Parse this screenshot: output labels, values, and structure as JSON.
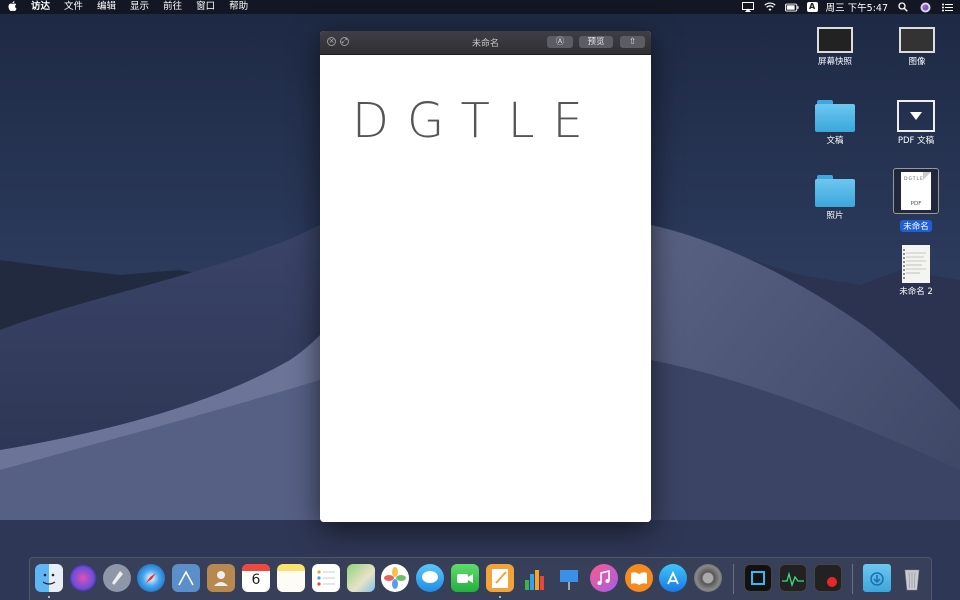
{
  "menubar": {
    "apple": "",
    "items": [
      "访达",
      "文件",
      "编辑",
      "显示",
      "前往",
      "窗口",
      "帮助"
    ],
    "battery": "",
    "input_method": "A",
    "clock": "周三 下午5:47"
  },
  "window": {
    "title": "未命名",
    "markup_button": "Ⓐ",
    "preview_button": "预览",
    "share_button": "⇧",
    "document_text": "DGTLE"
  },
  "desktop": {
    "icons": [
      {
        "label": "屏幕快照",
        "kind": "screenshot"
      },
      {
        "label": "图像",
        "kind": "screenshot"
      },
      {
        "label": "文稿",
        "kind": "folder"
      },
      {
        "label": "PDF 文稿",
        "kind": "folder-download"
      },
      {
        "label": "照片",
        "kind": "folder"
      },
      {
        "label": "未命名",
        "kind": "pdf",
        "selected": true,
        "thumb_text": "DGTLE",
        "badge": "PDF"
      },
      {
        "label": "未命名 2",
        "kind": "document"
      }
    ]
  },
  "dock": {
    "apps": [
      "finder-icon",
      "siri-icon",
      "launchpad-icon",
      "safari-icon",
      "mail-icon",
      "contacts-icon",
      "calendar-icon",
      "notes-icon",
      "reminders-icon",
      "maps-icon",
      "photos-icon",
      "messages-icon",
      "facetime-icon",
      "pages-icon",
      "numbers-icon",
      "keynote-icon",
      "itunes-icon",
      "books-icon",
      "appstore-icon",
      "system-preferences-icon",
      "screen-capture-icon",
      "activity-monitor-icon",
      "recorder-icon",
      "downloads-folder-icon",
      "trash-icon"
    ],
    "calendar_day": "6"
  }
}
